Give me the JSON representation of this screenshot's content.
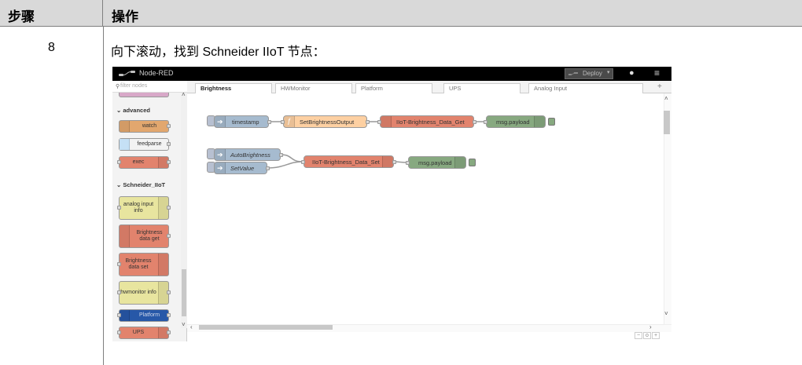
{
  "table": {
    "header_step": "步骤",
    "header_operation": "操作",
    "step_number": "8",
    "instruction": "向下滚动，找到 Schneider IIoT 节点："
  },
  "nodered": {
    "app_title": "Node-RED",
    "deploy_label": "Deploy",
    "palette_filter_placeholder": "filter nodes",
    "categories": {
      "advanced": "advanced",
      "schneider": "Schneider_IIoT"
    },
    "palette_nodes": {
      "watch": "watch",
      "feedparse": "feedparse",
      "exec": "exec",
      "analog_input": "analog input info",
      "brightness_get": "Brightness data get",
      "brightness_set": "Brightness data set",
      "hwmonitor": "hwmonitor info",
      "platform": "Platform",
      "ups": "UPS"
    },
    "tabs": [
      "Brightness",
      "HWMonitor",
      "Platform",
      "UPS",
      "Analog Input"
    ],
    "active_tab": "Brightness",
    "flow_nodes": {
      "timestamp": "timestamp",
      "set_brightness_output": "SetBrightnessOutput",
      "iiot_get": "IIoT-Brightness_Data_Get",
      "msg_payload_1": "msg.payload",
      "auto_brightness": "AutoBrightness",
      "set_value": "SetValue",
      "iiot_set": "IIoT-Brightness_Data_Set",
      "msg_payload_2": "msg.payload"
    },
    "colors": {
      "inject": "#a6bbcf",
      "function": "#fdd0a2",
      "iiot": "#e2836d",
      "debug": "#87a980",
      "analog": "#e8e59f",
      "platform_node": "#2758a8",
      "topbar": "#000000"
    }
  }
}
